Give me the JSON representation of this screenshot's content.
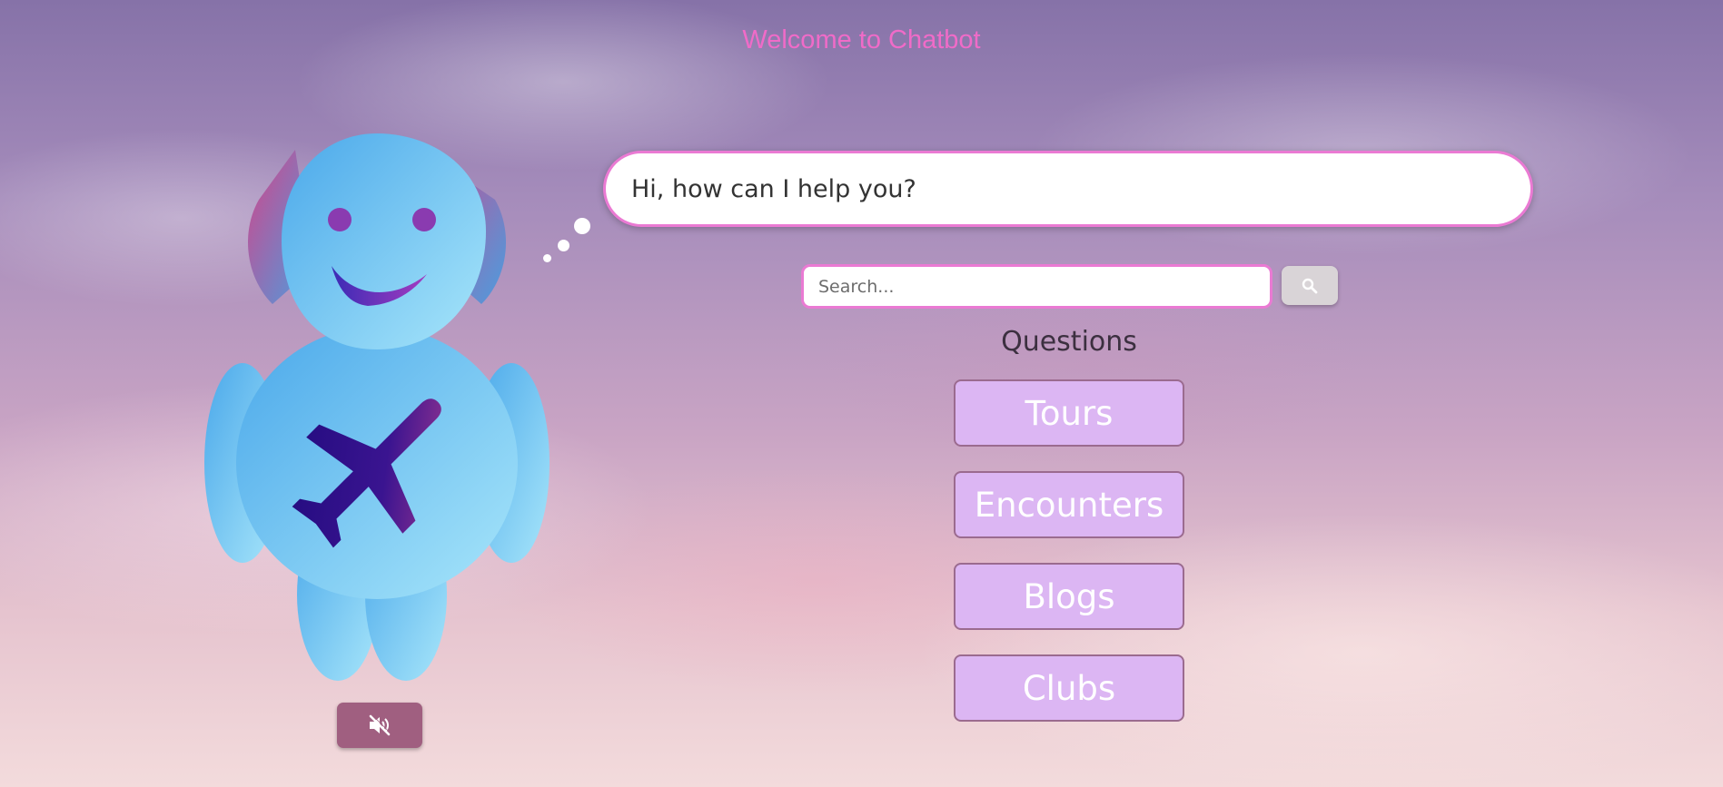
{
  "header": {
    "title": "Welcome to Chatbot"
  },
  "bot": {
    "speech": "Hi, how can I help you?",
    "avatar_icon": "robot-mascot-icon",
    "chest_icon": "airplane-icon"
  },
  "search": {
    "placeholder": "Search...",
    "value": "",
    "button_icon": "search-icon"
  },
  "questions": {
    "heading": "Questions",
    "items": [
      {
        "label": "Tours"
      },
      {
        "label": "Encounters"
      },
      {
        "label": "Blogs"
      },
      {
        "label": "Clubs"
      }
    ]
  },
  "audio": {
    "icon": "volume-mute-icon"
  },
  "colors": {
    "title": "#f06bc8",
    "accent_border": "#ea7ad3",
    "question_button_bg": "#dcb6f3",
    "mute_button_bg": "#a05f80",
    "bot_body": "#5ab8ee"
  }
}
